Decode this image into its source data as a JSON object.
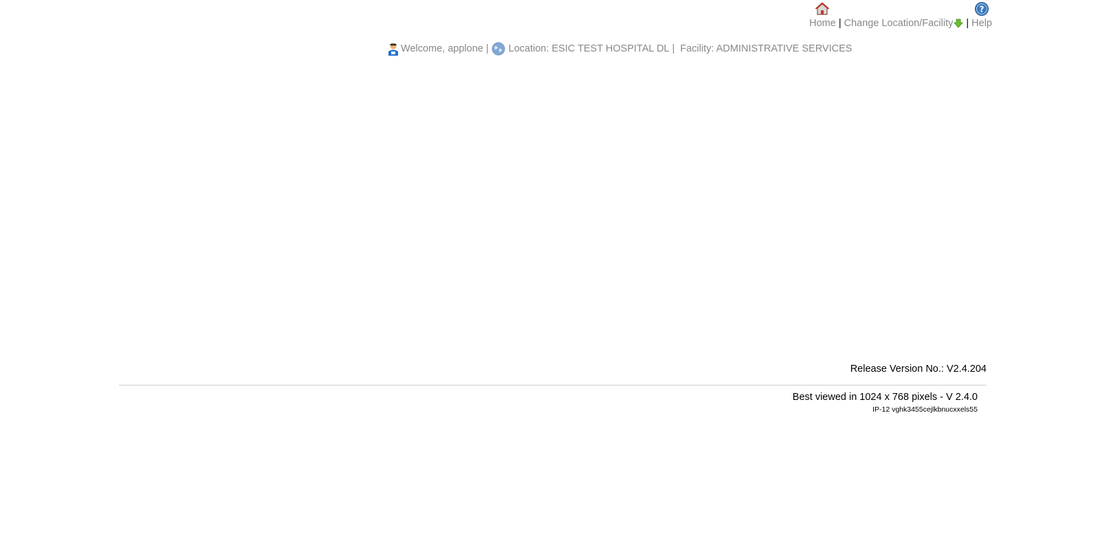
{
  "top_nav": {
    "home_label": "Home",
    "separator": "|",
    "change_location_label": "Change Location/Facility",
    "help_label": "Help",
    "home_icon": "home-icon",
    "help_icon": "help-icon",
    "change_icon": "down-arrow-icon"
  },
  "welcome_bar": {
    "welcome_text": "Welcome, applone",
    "separator": "|",
    "location_text": "Location: ESIC TEST HOSPITAL DL",
    "facility_text": "Facility: ADMINISTRATIVE SERVICES",
    "user_icon": "user-icon",
    "globe_icon": "globe-icon"
  },
  "footer": {
    "release_version": "Release Version No.: V2.4.204",
    "best_viewed": "Best viewed in 1024 x 768 pixels - V 2.4.0",
    "ip_info": "IP-12 vghk3455cejlkbnucxxels55"
  },
  "colors": {
    "link_gray": "#888888",
    "home_icon_red": "#c0392b",
    "help_icon_blue": "#3b7bbf",
    "arrow_green": "#6abf2e"
  }
}
